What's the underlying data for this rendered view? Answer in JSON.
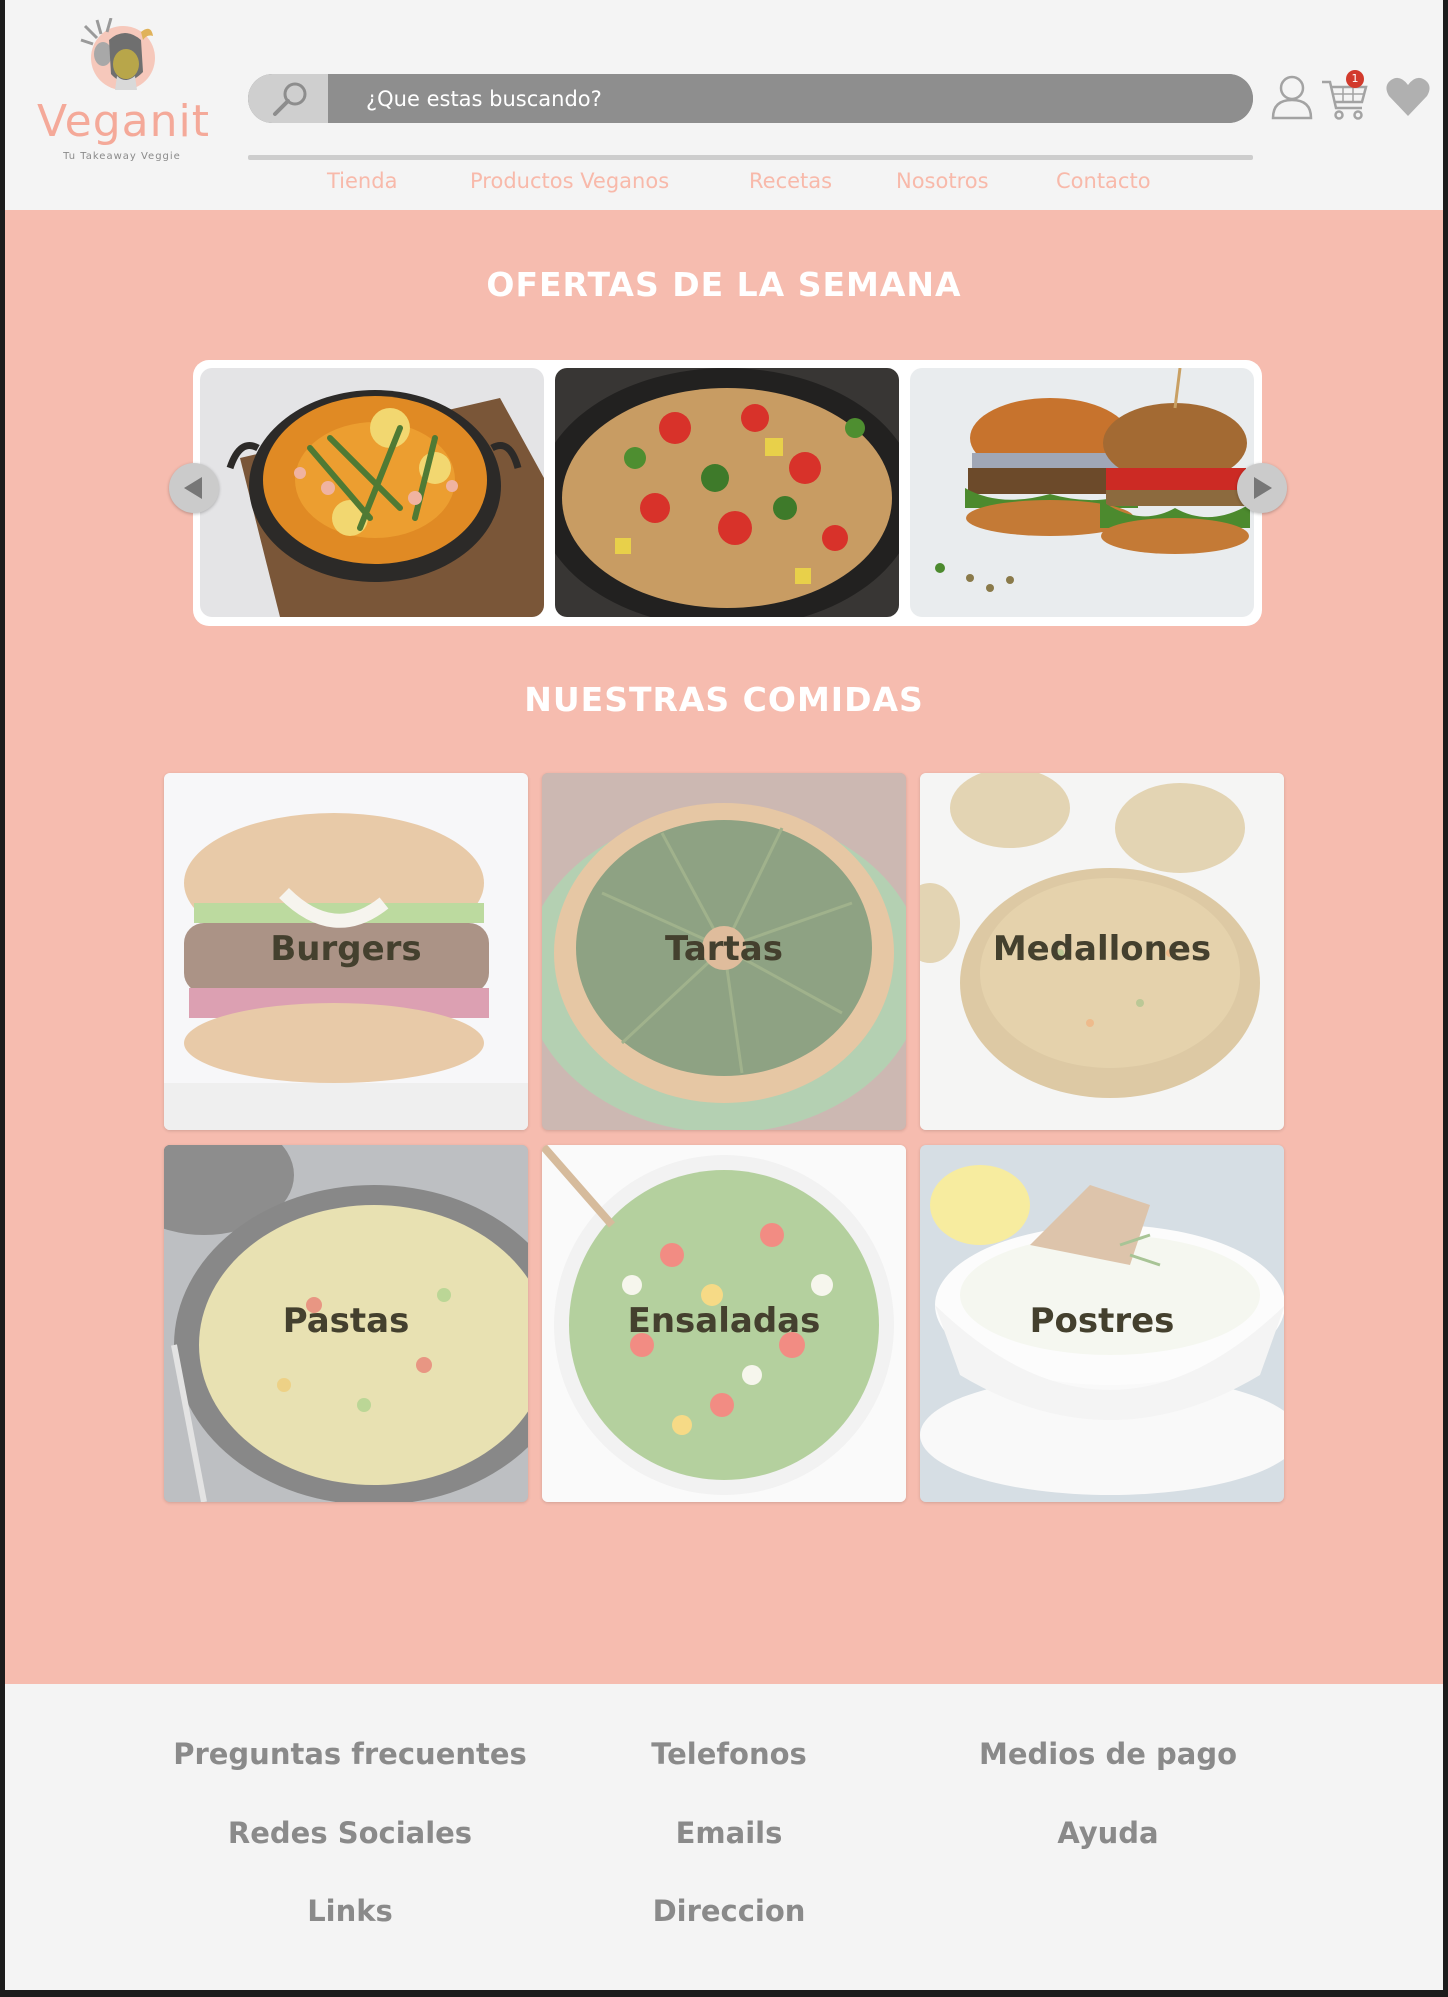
{
  "brand": {
    "name": "Veganit",
    "tagline": "Tu Takeaway Veggie",
    "accent": "#f4a999",
    "background": "#f6bcaf"
  },
  "search": {
    "placeholder": "¿Que estas buscando?",
    "icon": "search-icon"
  },
  "header_icons": {
    "user": "user-icon",
    "cart": "cart-icon",
    "cart_count": "1",
    "favorites": "heart-icon"
  },
  "nav": [
    "Tienda",
    "Productos Veganos",
    "Recetas",
    "Nosotros",
    "Contacto"
  ],
  "offers": {
    "title": "OFERTAS DE LA SEMANA",
    "slides": [
      "paella",
      "pasta-salad",
      "veggie-burgers"
    ],
    "prev_icon": "arrow-left-icon",
    "next_icon": "arrow-right-icon"
  },
  "meals": {
    "title": "NUESTRAS COMIDAS",
    "items": [
      "Burgers",
      "Tartas",
      "Medallones",
      "Pastas",
      "Ensaladas",
      "Postres"
    ]
  },
  "footer": {
    "links": [
      "Preguntas frecuentes",
      "Telefonos",
      "Medios de pago",
      "Redes Sociales",
      "Emails",
      "Ayuda",
      "Links",
      "Direccion"
    ]
  }
}
